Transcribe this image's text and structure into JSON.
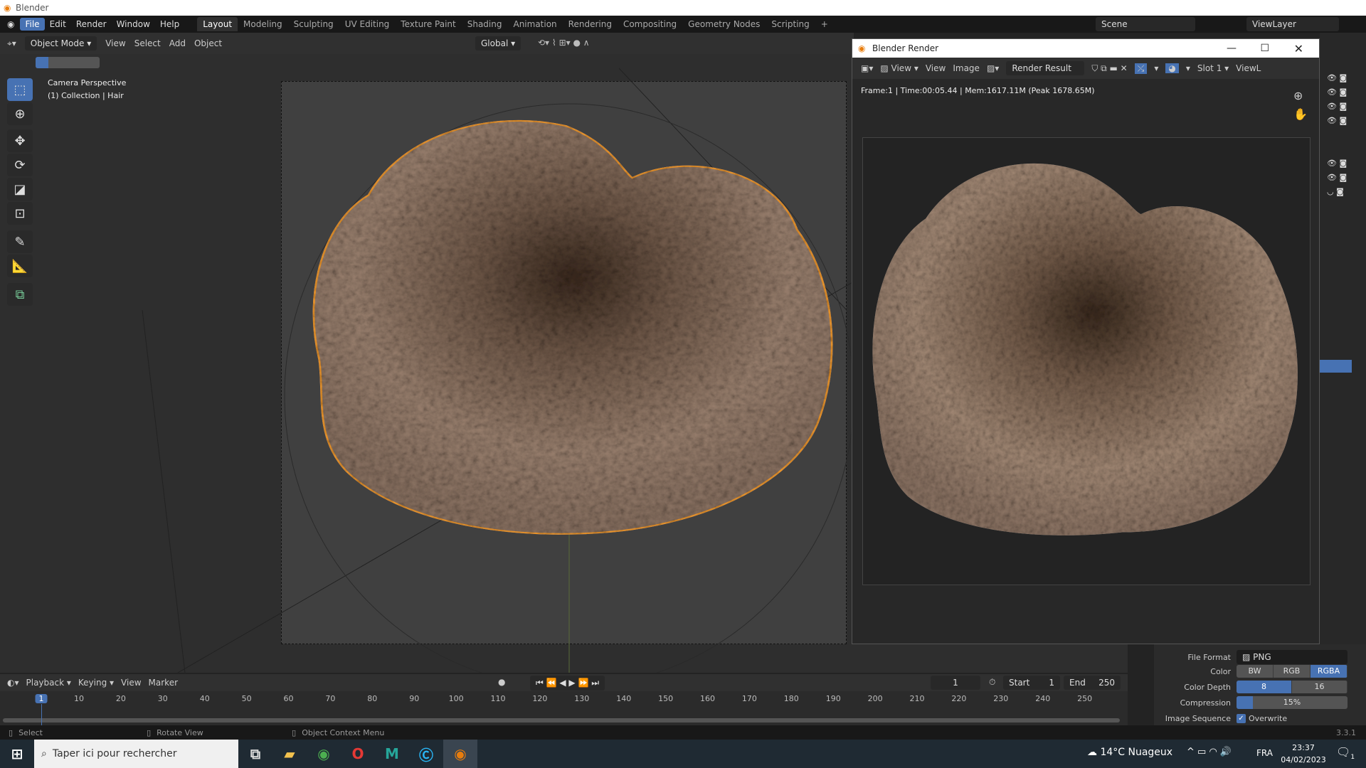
{
  "window": {
    "title": "Blender"
  },
  "menu": [
    "File",
    "Edit",
    "Render",
    "Window",
    "Help"
  ],
  "workspaces": [
    "Layout",
    "Modeling",
    "Sculpting",
    "UV Editing",
    "Texture Paint",
    "Shading",
    "Animation",
    "Rendering",
    "Compositing",
    "Geometry Nodes",
    "Scripting"
  ],
  "workspace_add": "+",
  "scene": "Scene",
  "view_layer": "ViewLayer",
  "viewport": {
    "mode": "Object Mode",
    "menus": [
      "View",
      "Select",
      "Add",
      "Object"
    ],
    "orientation": "Global",
    "overlay_title": "Camera Perspective",
    "overlay_sub": "(1) Collection | Hair"
  },
  "render": {
    "title": "Blender Render",
    "menus": [
      "View",
      "View",
      "Image"
    ],
    "image_name": "Render Result",
    "slot": "Slot 1",
    "view_layer": "ViewL",
    "info": "Frame:1 | Time:00:05.44 | Mem:1617.11M (Peak 1678.65M)"
  },
  "props": {
    "file_format_label": "File Format",
    "file_format": "PNG",
    "color_label": "Color",
    "color_opts": [
      "BW",
      "RGB",
      "RGBA"
    ],
    "depth_label": "Color Depth",
    "depth_opts": [
      "8",
      "16"
    ],
    "compression_label": "Compression",
    "compression": "15%",
    "compression_value": 15,
    "seq_label": "Image Sequence",
    "overwrite": "Overwrite"
  },
  "timeline": {
    "menus": [
      "Playback",
      "Keying",
      "View",
      "Marker"
    ],
    "current": "1",
    "start_label": "Start",
    "start": "1",
    "end_label": "End",
    "end": "250",
    "ticks": [
      "1",
      "10",
      "20",
      "30",
      "40",
      "50",
      "60",
      "70",
      "80",
      "90",
      "100",
      "110",
      "120",
      "130",
      "140",
      "150",
      "160",
      "170",
      "180",
      "190",
      "200",
      "210",
      "220",
      "230",
      "240",
      "250"
    ]
  },
  "status": {
    "select": "Select",
    "rotate": "Rotate View",
    "context": "Object Context Menu",
    "version": "3.3.1"
  },
  "taskbar": {
    "search": "Taper ici pour rechercher",
    "weather": "14°C  Nuageux",
    "lang": "FRA",
    "time": "23:37",
    "date": "04/02/2023",
    "notif": "1"
  },
  "colors": {
    "accent": "#4772b3",
    "outline": "#f29a2e",
    "hair": "#9c8270"
  }
}
